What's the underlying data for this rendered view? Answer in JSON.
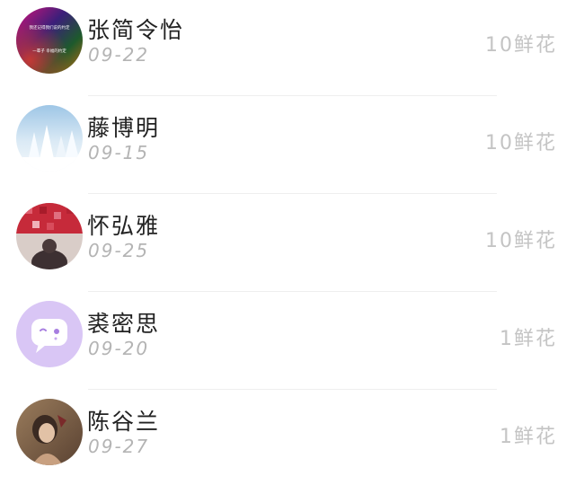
{
  "entries": [
    {
      "name": "张简令怡",
      "date": "09-22",
      "flowers": "10鲜花",
      "avatar_text_top": "我还记得我们说的约定",
      "avatar_text_bottom": "一辈子  幸福的约定",
      "avatar_colors": [
        "#c8126b",
        "#2a2a8a",
        "#1e6b2e",
        "#b86a14"
      ]
    },
    {
      "name": "藤博明",
      "date": "09-15",
      "flowers": "10鲜花",
      "avatar_colors": [
        "#a8cde6",
        "#e8f2fa",
        "#ffffff"
      ]
    },
    {
      "name": "怀弘雅",
      "date": "09-25",
      "flowers": "10鲜花",
      "avatar_colors": [
        "#b82230",
        "#d7c9c4",
        "#3a2f30"
      ]
    },
    {
      "name": "裘密思",
      "date": "09-20",
      "flowers": "1鲜花",
      "avatar_colors": [
        "#d8c4f4",
        "#ffffff",
        "#a77ee0"
      ]
    },
    {
      "name": "陈谷兰",
      "date": "09-27",
      "flowers": "1鲜花",
      "avatar_colors": [
        "#8a6a4a",
        "#d8b89a",
        "#3a2a22"
      ]
    }
  ]
}
